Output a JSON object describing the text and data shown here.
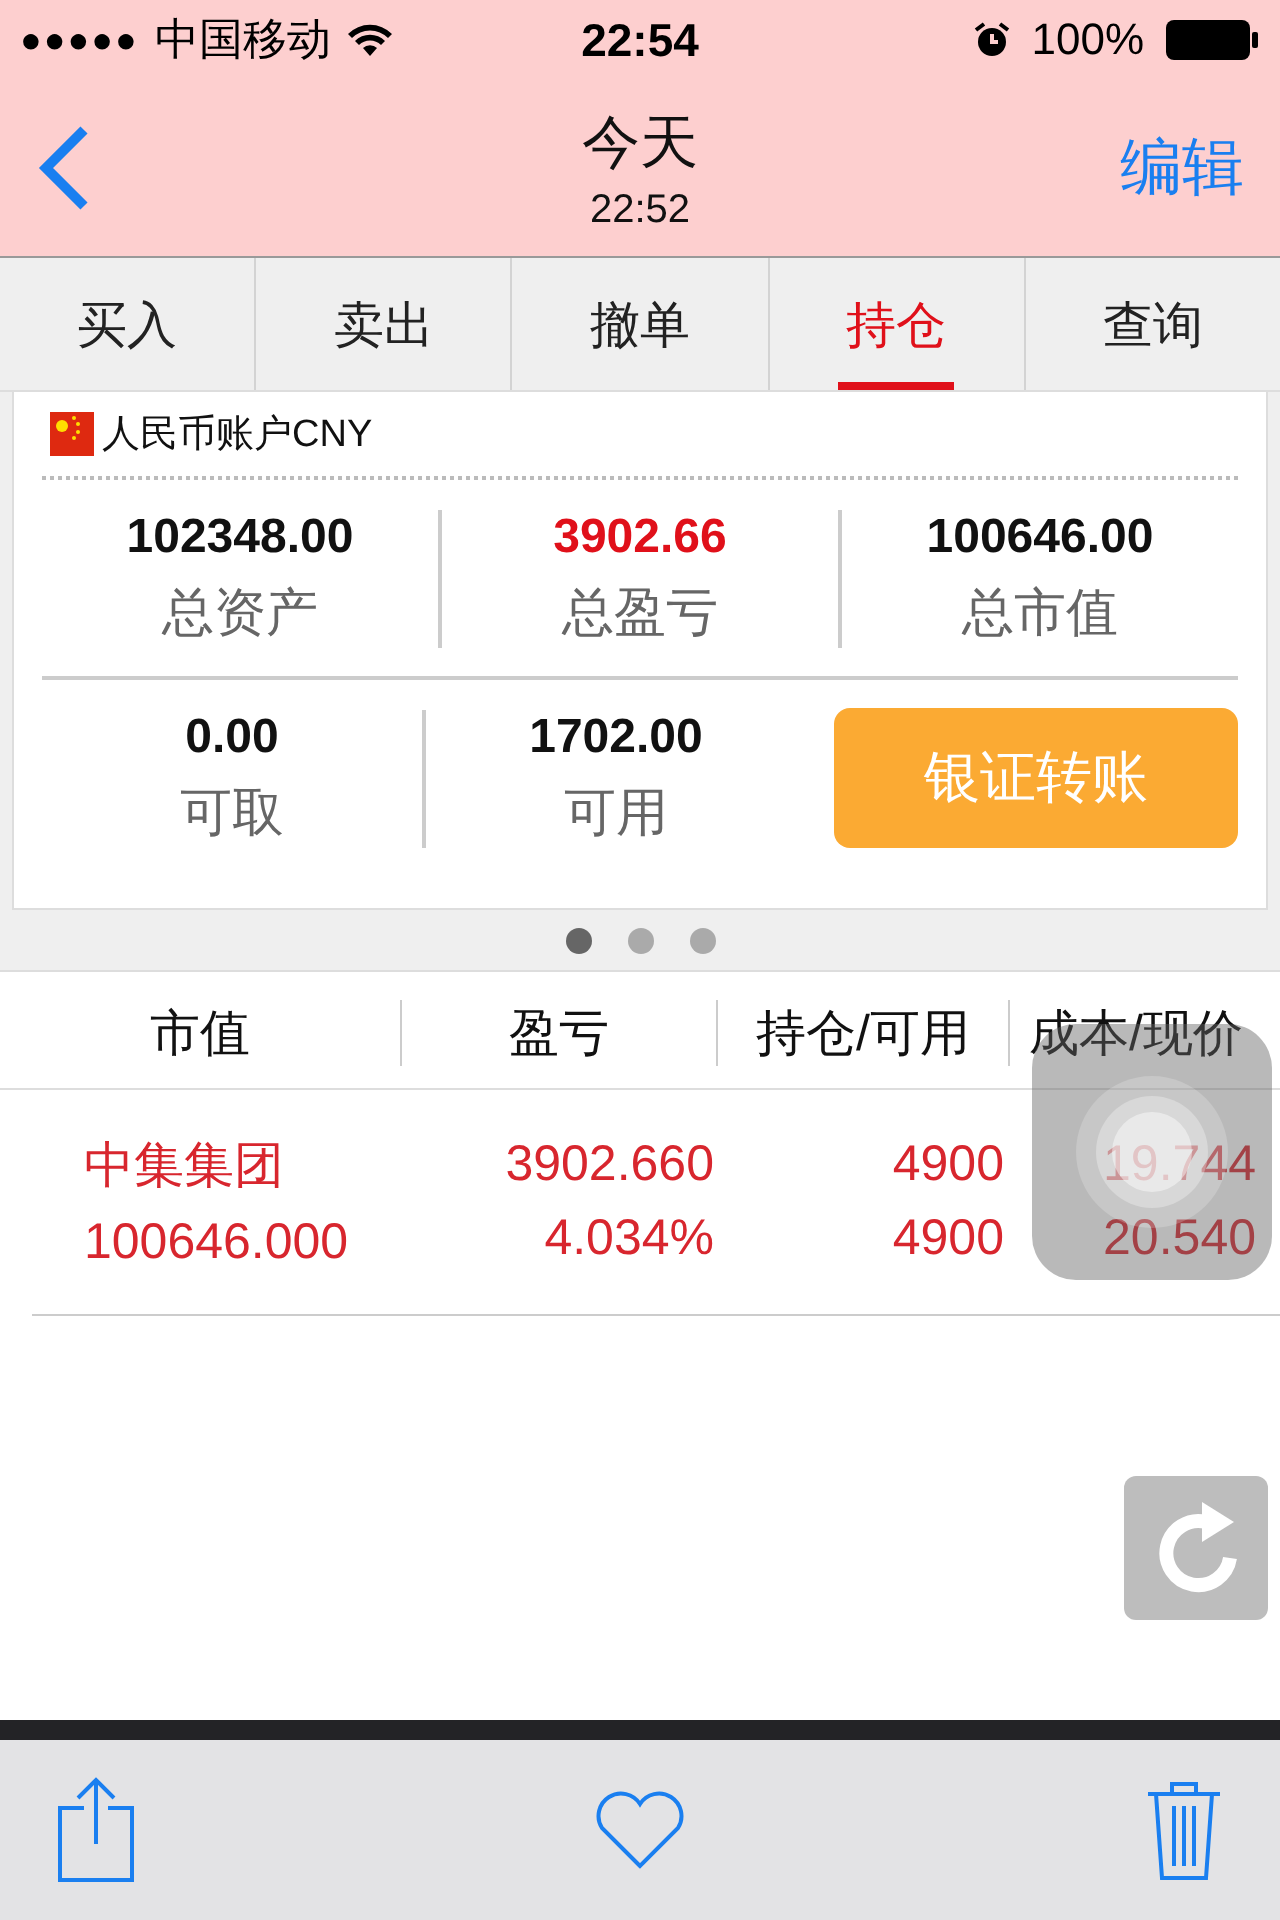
{
  "status_bar": {
    "signal_dots": "●●●●●",
    "carrier": "中国移动",
    "time": "22:54",
    "battery": "100%"
  },
  "nav": {
    "title": "今天",
    "subtitle": "22:52",
    "action": "编辑"
  },
  "tabs": [
    {
      "label": "买入",
      "selected": false
    },
    {
      "label": "卖出",
      "selected": false
    },
    {
      "label": "撤单",
      "selected": false
    },
    {
      "label": "持仓",
      "selected": true
    },
    {
      "label": "查询",
      "selected": false
    }
  ],
  "account": {
    "title": "人民币账户CNY",
    "stats": [
      {
        "value": "102348.00",
        "label": "总资产",
        "highlight": false
      },
      {
        "value": "3902.66",
        "label": "总盈亏",
        "highlight": true
      },
      {
        "value": "100646.00",
        "label": "总市值",
        "highlight": false
      }
    ],
    "balances": [
      {
        "value": "0.00",
        "label": "可取"
      },
      {
        "value": "1702.00",
        "label": "可用"
      }
    ],
    "button": "银证转账"
  },
  "pages": [
    {
      "selected": true
    },
    {
      "selected": false
    },
    {
      "selected": false
    }
  ],
  "table": {
    "columns": [
      "市值",
      "盈亏",
      "持仓/可用",
      "成本/现价"
    ],
    "rows": [
      {
        "color": "#d8262e",
        "cells": [
          [
            "中集集团",
            "100646.000"
          ],
          [
            "3902.660",
            "4.034%"
          ],
          [
            "4900",
            "4900"
          ],
          [
            "19.744",
            "20.540"
          ]
        ]
      }
    ]
  }
}
